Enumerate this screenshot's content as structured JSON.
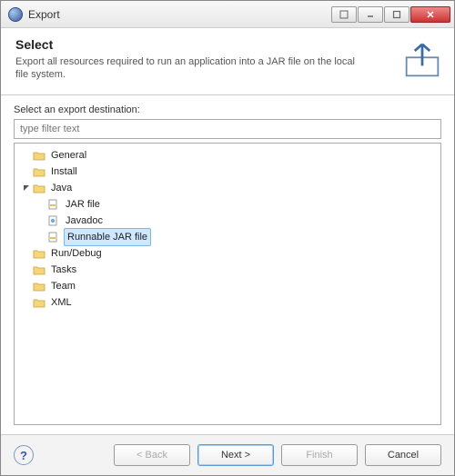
{
  "window": {
    "title": "Export"
  },
  "header": {
    "title": "Select",
    "subtitle": "Export all resources required to run an application into a JAR file on the local file system."
  },
  "body": {
    "destination_label": "Select an export destination:",
    "filter_placeholder": "type filter text"
  },
  "tree": {
    "items": [
      {
        "label": "General",
        "expanded": false,
        "icon": "folder"
      },
      {
        "label": "Install",
        "expanded": false,
        "icon": "folder"
      },
      {
        "label": "Java",
        "expanded": true,
        "icon": "folder-open",
        "children": [
          {
            "label": "JAR file",
            "icon": "jar"
          },
          {
            "label": "Javadoc",
            "icon": "javadoc"
          },
          {
            "label": "Runnable JAR file",
            "icon": "jar-run",
            "selected": true
          }
        ]
      },
      {
        "label": "Run/Debug",
        "expanded": false,
        "icon": "folder"
      },
      {
        "label": "Tasks",
        "expanded": false,
        "icon": "folder"
      },
      {
        "label": "Team",
        "expanded": false,
        "icon": "folder"
      },
      {
        "label": "XML",
        "expanded": false,
        "icon": "folder"
      }
    ]
  },
  "buttons": {
    "back": "< Back",
    "next": "Next >",
    "finish": "Finish",
    "cancel": "Cancel"
  }
}
